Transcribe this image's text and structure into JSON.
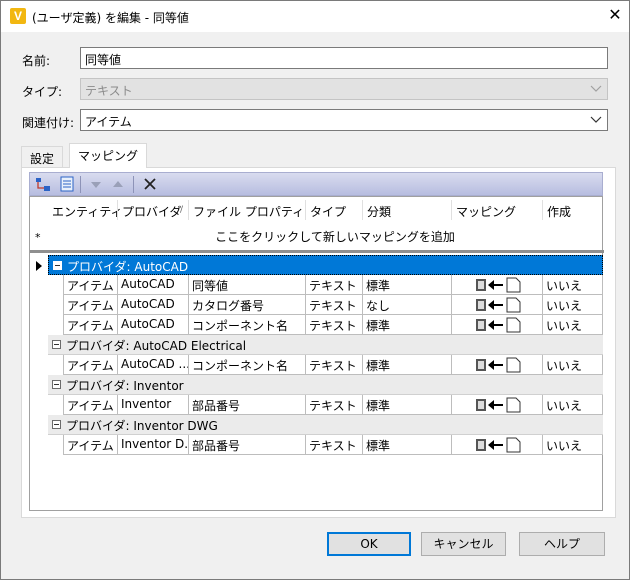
{
  "window": {
    "title": "(ユーザ定義) を編集 - 同等値",
    "app_icon_letter": "V",
    "close_symbol": "✕"
  },
  "form": {
    "name_label": "名前:",
    "name_value": "同等値",
    "type_label": "タイプ:",
    "type_value": "テキスト",
    "assoc_label": "関連付け:",
    "assoc_value": "アイテム"
  },
  "tabs": [
    {
      "label": "設定"
    },
    {
      "label": "マッピング"
    }
  ],
  "grid": {
    "columns": [
      "エンティティ",
      "プロバイダ",
      "ファイル プロパティ",
      "タイプ",
      "分類",
      "マッピング",
      "作成"
    ],
    "new_row_text": "ここをクリックして新しいマッピングを追加",
    "new_row_marker": "*",
    "groups": [
      {
        "label": "プロバイダ: AutoCAD",
        "rows": [
          [
            "アイテム",
            "AutoCAD",
            "同等値",
            "テキスト",
            "標準",
            "いいえ"
          ],
          [
            "アイテム",
            "AutoCAD",
            "カタログ番号",
            "テキスト",
            "なし",
            "いいえ"
          ],
          [
            "アイテム",
            "AutoCAD",
            "コンポーネント名",
            "テキスト",
            "標準",
            "いいえ"
          ]
        ]
      },
      {
        "label": "プロバイダ: AutoCAD Electrical",
        "rows": [
          [
            "アイテム",
            "AutoCAD ...",
            "コンポーネント名",
            "テキスト",
            "標準",
            "いいえ"
          ]
        ]
      },
      {
        "label": "プロバイダ: Inventor",
        "rows": [
          [
            "アイテム",
            "Inventor",
            "部品番号",
            "テキスト",
            "標準",
            "いいえ"
          ]
        ]
      },
      {
        "label": "プロバイダ: Inventor DWG",
        "rows": [
          [
            "アイテム",
            "Inventor D...",
            "部品番号",
            "テキスト",
            "標準",
            "いいえ"
          ]
        ]
      }
    ]
  },
  "buttons": {
    "ok": "OK",
    "cancel": "キャンセル",
    "help": "ヘルプ"
  },
  "colors": {
    "selection": "#0078d7",
    "app_icon": "#f2b711"
  }
}
